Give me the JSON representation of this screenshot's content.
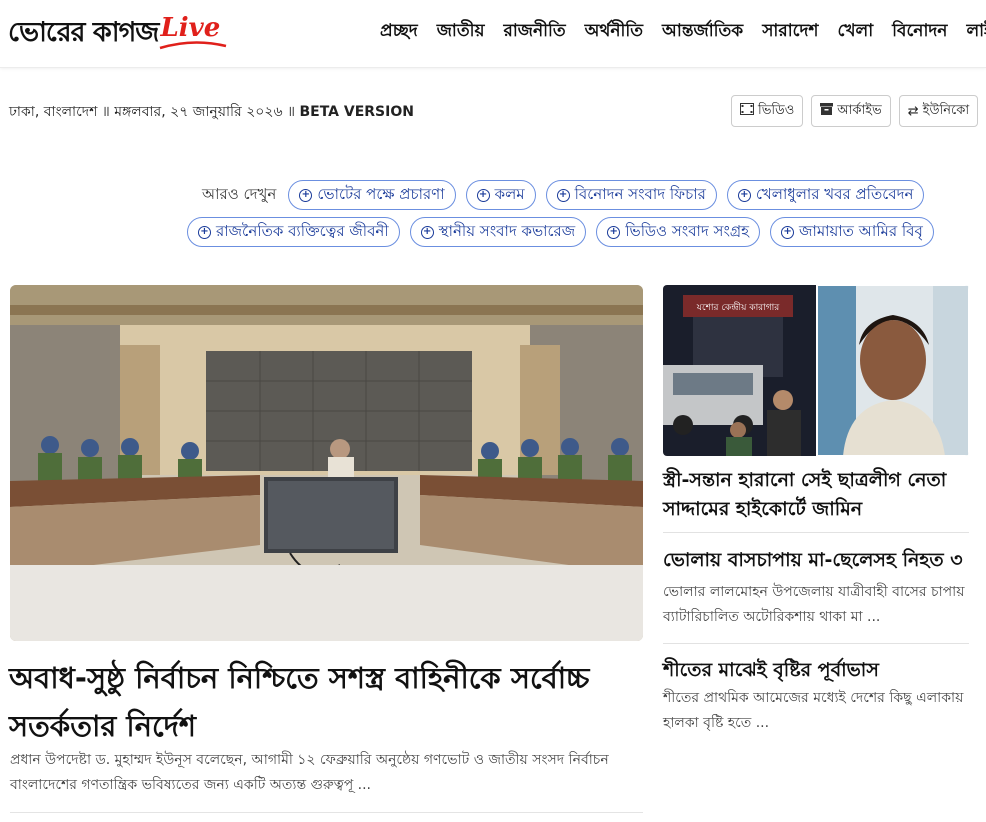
{
  "header": {
    "logo_text": "ভোরের কাগজ",
    "logo_live": "Live",
    "nav": [
      "প্রচ্ছদ",
      "জাতীয়",
      "রাজনীতি",
      "অর্থনীতি",
      "আন্তর্জাতিক",
      "সারাদেশ",
      "খেলা",
      "বিনোদন",
      "লাইফ"
    ]
  },
  "dateline": {
    "location": "ঢাকা, বাংলাদেশ",
    "sep": "॥",
    "date": "মঙ্গলবার, ২৭ জানুয়ারি ২০২৬",
    "version": "BETA VERSION"
  },
  "buttons": {
    "video": "ভিডিও",
    "archive": "আর্কাইভ",
    "unicode": "ইউনিকো"
  },
  "tags": {
    "label": "আরও দেখুন",
    "row1": [
      "ভোটের পক্ষে প্রচারণা",
      "কলম",
      "বিনোদন সংবাদ ফিচার",
      "খেলাধুলার খবর প্রতিবেদন"
    ],
    "row2": [
      "রাজনৈতিক ব্যক্তিত্বের জীবনী",
      "স্থানীয় সংবাদ কভারেজ",
      "ভিডিও সংবাদ সংগ্রহ",
      "জামায়াত আমির বিবৃ"
    ]
  },
  "lead": {
    "title": "অবাধ-সুষ্ঠু নির্বাচন নিশ্চিতে সশস্ত্র বাহিনীকে সর্বোচ্চ সতর্কতার নির্দেশ",
    "summary": "প্রধান উপদেষ্টা ড. মুহাম্মদ ইউনূস বলেছেন, আগামী ১২ ফেব্রুয়ারি অনুষ্ঠেয় গণভোট ও জাতীয় সংসদ নির্বাচন বাংলাদেশের গণতান্ত্রিক ভবিষ্যতের জন্য একটি অত্যন্ত গুরুত্বপূ ..."
  },
  "side": {
    "story1_title": "স্ত্রী-সন্তান হারানো সেই ছাত্রলীগ নেতা সাদ্দামের হাইকোর্টে জামিন",
    "story2_title": "ভোলায় বাসচাপায় মা-ছেলেসহ নিহত ৩",
    "story2_summary": "ভোলার লালমোহন উপজেলায় যাত্রীবাহী বাসের চাপায় ব্যাটারিচালিত অটোরিকশায় থাকা মা ...",
    "story3_title": "শীতের মাঝেই বৃষ্টির পূর্বাভাস",
    "story3_summary": "শীতের প্রাথমিক আমেজের মধ্যেই দেশের কিছু এলাকায় হালকা বৃষ্টি হতে ...",
    "gate_sign": "যশোর কেন্দ্রীয় কারাগার"
  },
  "colors": {
    "brand_red": "#e0201b",
    "tag_blue": "#1a3b9a"
  }
}
